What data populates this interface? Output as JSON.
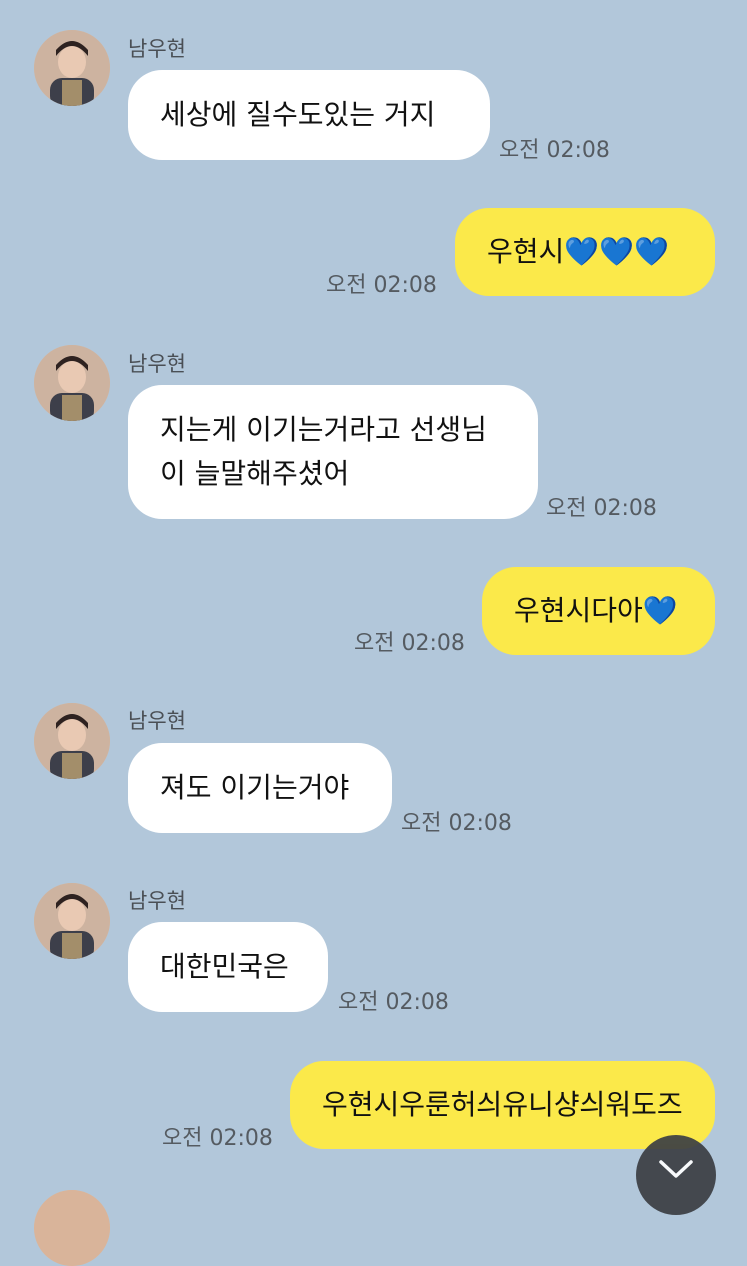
{
  "messages": [
    {
      "sender": "남우현",
      "text": "세상에 질수도있는 거지",
      "time": "오전 02:08"
    },
    {
      "text": "우현시💙💙💙",
      "time": "오전 02:08"
    },
    {
      "sender": "남우현",
      "line1": "지는게 이기는거라고 선생님",
      "line2": "이 늘말해주셨어",
      "time": "오전 02:08"
    },
    {
      "text": "우현시다아💙",
      "time": "오전 02:08"
    },
    {
      "sender": "남우현",
      "text": "져도 이기는거야",
      "time": "오전 02:08"
    },
    {
      "sender": "남우현",
      "text": "대한민국은",
      "time": "오전 02:08"
    },
    {
      "text": "우현시우룬허싀유니샹싀워도즈",
      "time": "오전 02:08"
    }
  ],
  "icons": {
    "avatar": "profile-photo",
    "scroll": "chevron-down-icon"
  },
  "colors": {
    "background": "#b2c7da",
    "incoming": "#ffffff",
    "outgoing": "#fbe94a"
  }
}
